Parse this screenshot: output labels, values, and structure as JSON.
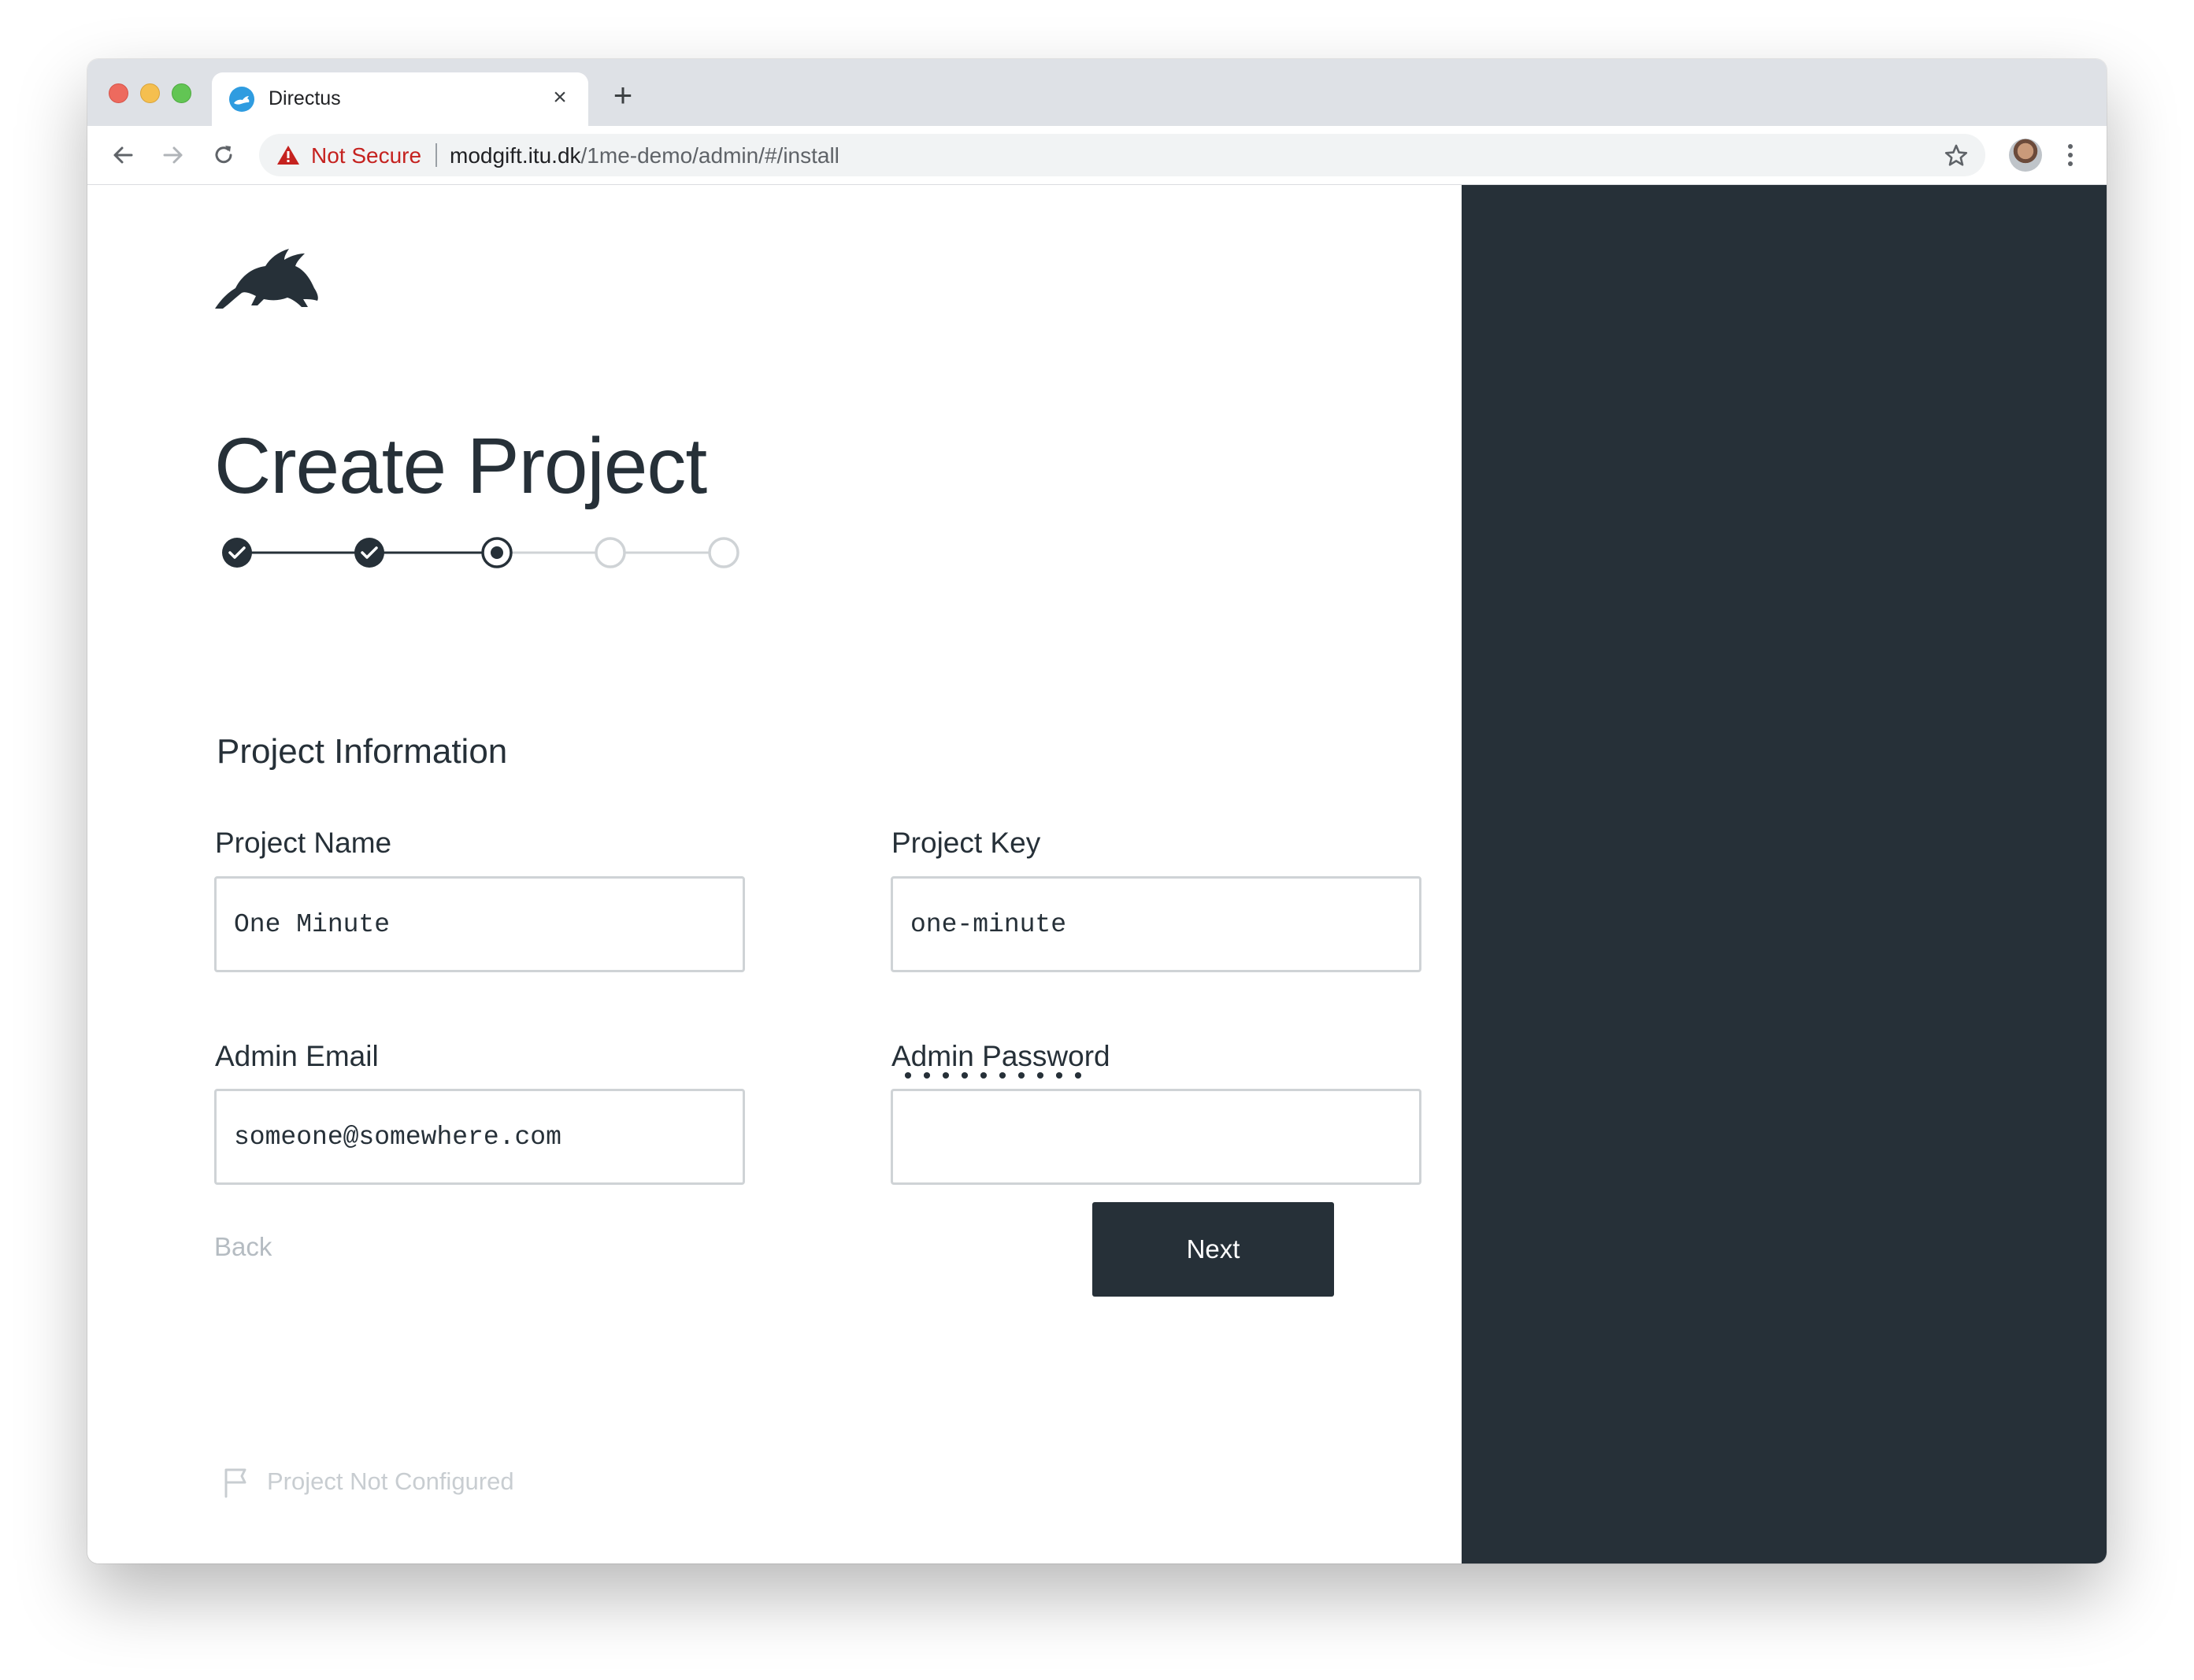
{
  "browser": {
    "tab_title": "Directus",
    "security_label": "Not Secure",
    "url_host": "modgift.itu.dk",
    "url_path": "/1me-demo/admin/#/install"
  },
  "page": {
    "title": "Create Project",
    "steps": [
      {
        "state": "complete"
      },
      {
        "state": "complete"
      },
      {
        "state": "current"
      },
      {
        "state": "upcoming"
      },
      {
        "state": "upcoming"
      }
    ],
    "section_title": "Project Information",
    "fields": {
      "project_name": {
        "label": "Project Name",
        "value": "One Minute"
      },
      "project_key": {
        "label": "Project Key",
        "value": "one-minute"
      },
      "admin_email": {
        "label": "Admin Email",
        "value": "someone@somewhere.com"
      },
      "admin_password": {
        "label": "Admin Password",
        "masked_value": "••••••••••"
      }
    },
    "back_label": "Back",
    "next_label": "Next",
    "status_text": "Project Not Configured"
  },
  "colors": {
    "primary": "#263038",
    "side_panel": "#263038",
    "muted_text": "#b5bcc2",
    "input_border": "#cfd3d6",
    "warning_red": "#c5221f"
  },
  "icons": [
    "back-arrow-icon",
    "forward-arrow-icon",
    "reload-icon",
    "warning-icon",
    "star-icon",
    "kebab-menu-icon",
    "rabbit-logo-icon",
    "check-icon",
    "flag-icon",
    "close-icon",
    "plus-icon"
  ]
}
